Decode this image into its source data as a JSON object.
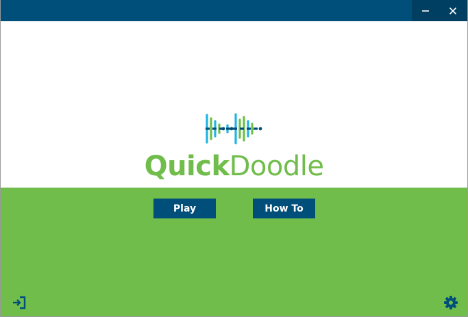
{
  "window": {
    "minimize_icon": "minimize-icon",
    "close_icon": "close-icon"
  },
  "app": {
    "logo_word_bold": "Quick",
    "logo_word_light": "Doodle"
  },
  "menu": {
    "play_label": "Play",
    "howto_label": "How To"
  },
  "footer": {
    "exit_icon": "exit-icon",
    "settings_icon": "gear-icon"
  },
  "colors": {
    "titlebar": "#004e7a",
    "titlebar_controls": "#003e62",
    "brand_green": "#70bd4b",
    "button_bg": "#004e7a",
    "logo_blue": "#1eb4e6",
    "icon_color": "#004e7a"
  }
}
